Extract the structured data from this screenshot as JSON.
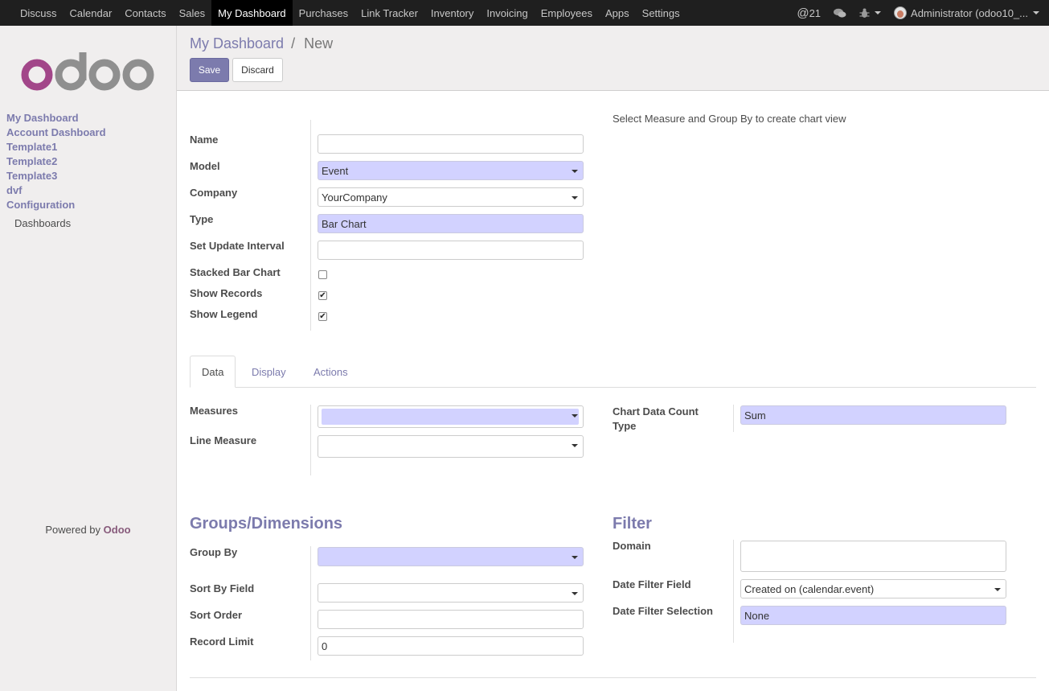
{
  "topbar": {
    "menu": [
      "Discuss",
      "Calendar",
      "Contacts",
      "Sales",
      "My Dashboard",
      "Purchases",
      "Link Tracker",
      "Inventory",
      "Invoicing",
      "Employees",
      "Apps",
      "Settings"
    ],
    "active": "My Dashboard",
    "message_count": "21",
    "user": "Administrator (odoo10_..."
  },
  "sidebar": {
    "logo_text": "odoo",
    "items": [
      {
        "label": "My Dashboard"
      },
      {
        "label": "Account Dashboard"
      },
      {
        "label": "Template1"
      },
      {
        "label": "Template2"
      },
      {
        "label": "Template3"
      },
      {
        "label": "dvf"
      },
      {
        "label": "Configuration"
      }
    ],
    "sub_item": "Dashboards",
    "powered_prefix": "Powered by",
    "powered_brand": "Odoo"
  },
  "control": {
    "breadcrumb_parent": "My Dashboard",
    "breadcrumb_sep": "/",
    "breadcrumb_current": "New",
    "save_label": "Save",
    "discard_label": "Discard"
  },
  "form": {
    "hint": "Select Measure and Group By to create chart view",
    "name_label": "Name",
    "name_value": "",
    "model_label": "Model",
    "model_value": "Event",
    "company_label": "Company",
    "company_value": "YourCompany",
    "type_label": "Type",
    "type_value": "Bar Chart",
    "interval_label": "Set Update Interval",
    "interval_value": "",
    "stacked_label": "Stacked Bar Chart",
    "stacked_checked": false,
    "show_records_label": "Show Records",
    "show_records_checked": true,
    "show_legend_label": "Show Legend",
    "show_legend_checked": true
  },
  "tabs": [
    "Data",
    "Display",
    "Actions"
  ],
  "data_tab": {
    "measures_label": "Measures",
    "line_measure_label": "Line Measure",
    "count_type_label_1": "Chart Data Count",
    "count_type_label_2": "Type",
    "count_type_value": "Sum"
  },
  "groups": {
    "title": "Groups/Dimensions",
    "group_by_label": "Group By",
    "sort_field_label": "Sort By Field",
    "sort_order_label": "Sort Order",
    "record_limit_label": "Record Limit",
    "record_limit_value": "0"
  },
  "filter": {
    "title": "Filter",
    "domain_label": "Domain",
    "date_field_label": "Date Filter Field",
    "date_field_value": "Created on (calendar.event)",
    "date_selection_label": "Date Filter Selection",
    "date_selection_value": "None"
  },
  "colors": {
    "brand": "#7c7bad",
    "required": "#d2d2ff",
    "odoo_purple": "#875a7b"
  }
}
